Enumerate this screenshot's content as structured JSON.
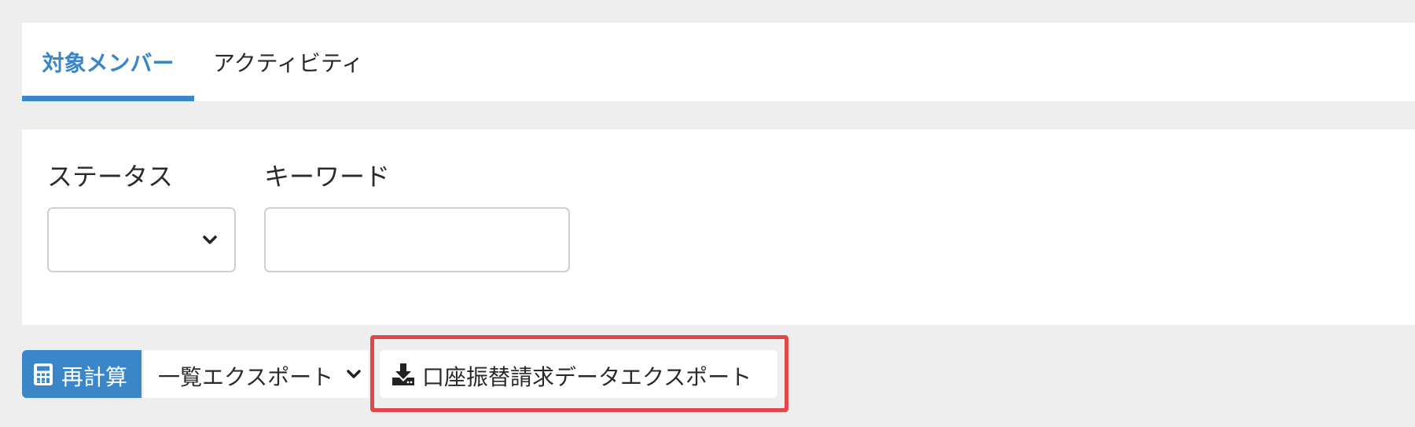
{
  "tabs": [
    {
      "label": "対象メンバー",
      "active": true
    },
    {
      "label": "アクティビティ",
      "active": false
    }
  ],
  "filters": {
    "status_label": "ステータス",
    "status_value": "",
    "keyword_label": "キーワード",
    "keyword_value": "",
    "keyword_placeholder": ""
  },
  "actions": {
    "recalc_label": "再計算",
    "list_export_label": "一覧エクスポート",
    "bank_export_label": "口座振替請求データエクスポート"
  },
  "colors": {
    "accent": "#3a86c8",
    "highlight": "#e0484b",
    "background": "#eeeeee"
  },
  "icons": {
    "recalc": "calculator-icon",
    "list_export_dropdown": "chevron-down-icon",
    "bank_export": "download-icon",
    "status_dropdown": "chevron-down-icon"
  }
}
